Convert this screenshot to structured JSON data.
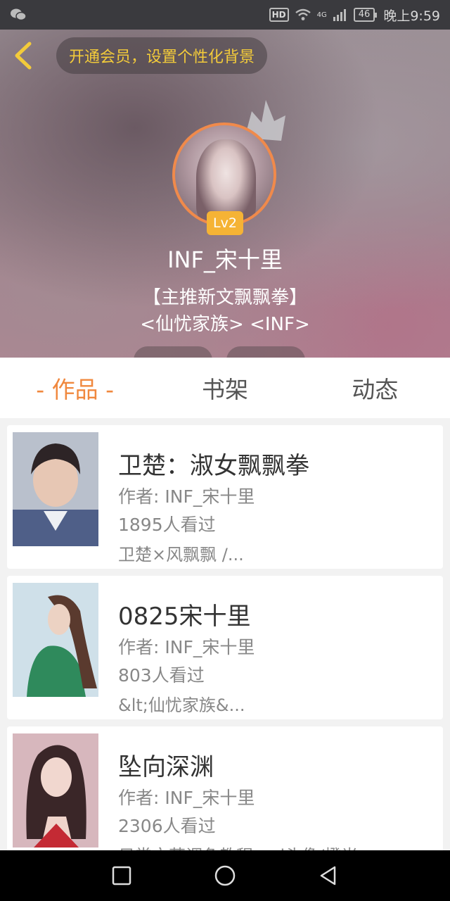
{
  "status_bar": {
    "wechat_icon": "wechat-icon",
    "hd_label": "HD",
    "network_label": "4G",
    "battery_level": "46",
    "time": "晚上9:59"
  },
  "header": {
    "vip_prompt": "开通会员，设置个性化背景",
    "level_badge": "Lv2",
    "username": "INF_宋十里",
    "bio_line1": "【主推新文飘飘拳】",
    "bio_line2": "<仙忧家族> <INF>"
  },
  "tabs": [
    {
      "label": "作品",
      "active": true,
      "decorated": "- 作品 -"
    },
    {
      "label": "书架",
      "active": false
    },
    {
      "label": "动态",
      "active": false
    }
  ],
  "works": [
    {
      "title": "卫楚：淑女飘飘拳",
      "author": "作者: INF_宋十里",
      "views": "1895人看过",
      "tags": "卫楚×风飘飘 /..."
    },
    {
      "title": "0825宋十里",
      "author": "作者: INF_宋十里",
      "views": "803人看过",
      "tags": "&lt;仙忧家族&..."
    },
    {
      "title": "坠向深渊",
      "author": "作者: INF_宋十里",
      "views": "2306人看过",
      "tags": "日常文萃调色教程and头像/橙光..."
    }
  ],
  "colors": {
    "accent": "#f0883e",
    "vip_text": "#f3cb3a",
    "level_badge": "#f5b335"
  }
}
